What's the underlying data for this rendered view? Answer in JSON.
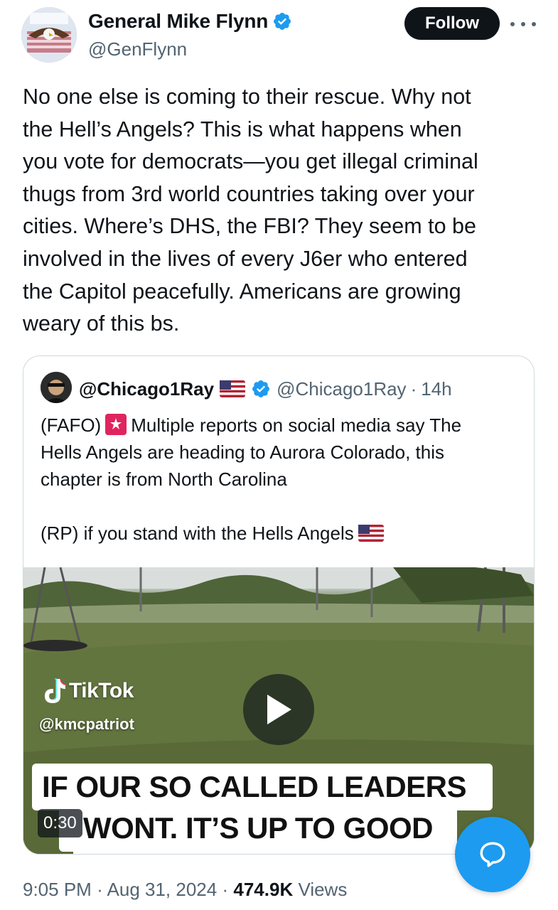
{
  "tweet": {
    "author_name": "General Mike Flynn",
    "author_handle": "@GenFlynn",
    "follow_label": "Follow",
    "text": "No one else is coming to their rescue. Why not\nthe Hell’s Angels? This is what happens when\nyou vote for democrats—you get illegal criminal\nthugs from 3rd world countries taking over your\ncities. Where’s DHS, the FBI? They seem to be\ninvolved in the lives of every J6er who entered\nthe Capitol peacefully. Americans are growing\nweary of this bs.",
    "time": "9:05 PM",
    "date": "Aug 31, 2024",
    "views_count": "474.9K",
    "views_label": "Views",
    "separator": "·"
  },
  "quote": {
    "author_name": "@Chicago1Ray",
    "author_handle": "@Chicago1Ray",
    "age": "14h",
    "separator": "·",
    "line1_prefix": "(FAFO)",
    "line1_rest": "Multiple reports on social media say The",
    "line2": "Hells Angels are heading to Aurora Colorado, this",
    "line3": "chapter is from North Carolina",
    "line4": "(RP) if you stand with the Hells Angels",
    "video": {
      "platform": "TikTok",
      "handle": "@kmcpatriot",
      "caption_line1": "IF OUR SO CALLED LEADERS",
      "caption_line2": "WONT. IT’S UP TO GOOD",
      "duration": "0:30"
    }
  },
  "colors": {
    "text_primary": "#0f1419",
    "text_secondary": "#536471",
    "verified_blue": "#1d9bf0",
    "border": "#cfd9de"
  },
  "icons": [
    "verified-badge-icon",
    "more-icon",
    "us-flag-icon",
    "siren-emoji-icon",
    "play-icon",
    "tiktok-logo-icon",
    "reply-bubble-icon"
  ]
}
